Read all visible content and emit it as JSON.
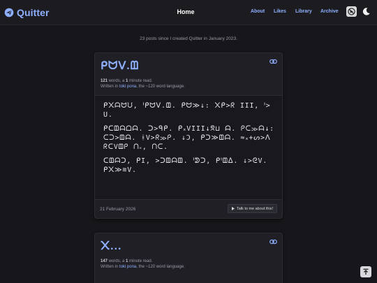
{
  "header": {
    "logo_text": "Quitter",
    "page_title": "Home",
    "nav": [
      "About",
      "Likes",
      "Library",
      "Archive"
    ]
  },
  "intro": "23 posts since I created Quitter in January 2023.",
  "posts": [
    {
      "title": "ᑭᗢᐯ.ᗶ",
      "words": "121",
      "read_pre": " words, a ",
      "read_num": "1",
      "read_post": " minute read.",
      "written_pre": "Written in ",
      "language": "toki pona",
      "written_post": ", the ~120 word language.",
      "paragraphs": [
        "ᑭ᙭ᗩᗢᙀ, ᑊᑭᗢᐯ.ᗶ. ᑭᗢ≫↓: ᙭ᑭ>ᖇ III, ᑊ>Ս.",
        "ᑭᑕᗶᗩᗝᗩ. ᑐ>ᑫᑭ. ᑭ᙮VIII↓ᘝ⊔ ᗩ. ᑭᑕ≫ᗩ↓: ᑕᑐ>ᗶᗩ. ᚼV>ᖇ≫ᑭ. ↓Ͻ, ᑭᑐ≫ᗶᗩ. ≈᙮+ᔕ>ᐱᖇᑕVᗶᑭ ᑎ᙮, ᑎᑕ.",
        "ᑕᗶᗩᑐ, ᑭI, >ᑐᗶᗩᗶ. ᑊᕲᑐ, ᑭᑊᗶᐃ. ↓>ᘓV. ᑭ᙭≫≋V."
      ],
      "date": "21 February 2026",
      "talk_label": "Talk to me about this!"
    },
    {
      "title": "᙭...",
      "words": "147",
      "read_pre": " words, a ",
      "read_num": "1",
      "read_post": " minute read.",
      "written_pre": "Written in ",
      "language": "toki pona",
      "written_post": ", the ~120 word language."
    }
  ],
  "icons": {
    "logo": "paper-plane-icon",
    "no_animation": "no-animation-icon",
    "theme": "moon-icon",
    "permalink": "link-icon",
    "talk": "play-icon",
    "to_top": "arrow-to-top-icon"
  },
  "colors": {
    "accent": "#8fb0ff",
    "background": "#17171b",
    "card": "#1f1f25"
  }
}
